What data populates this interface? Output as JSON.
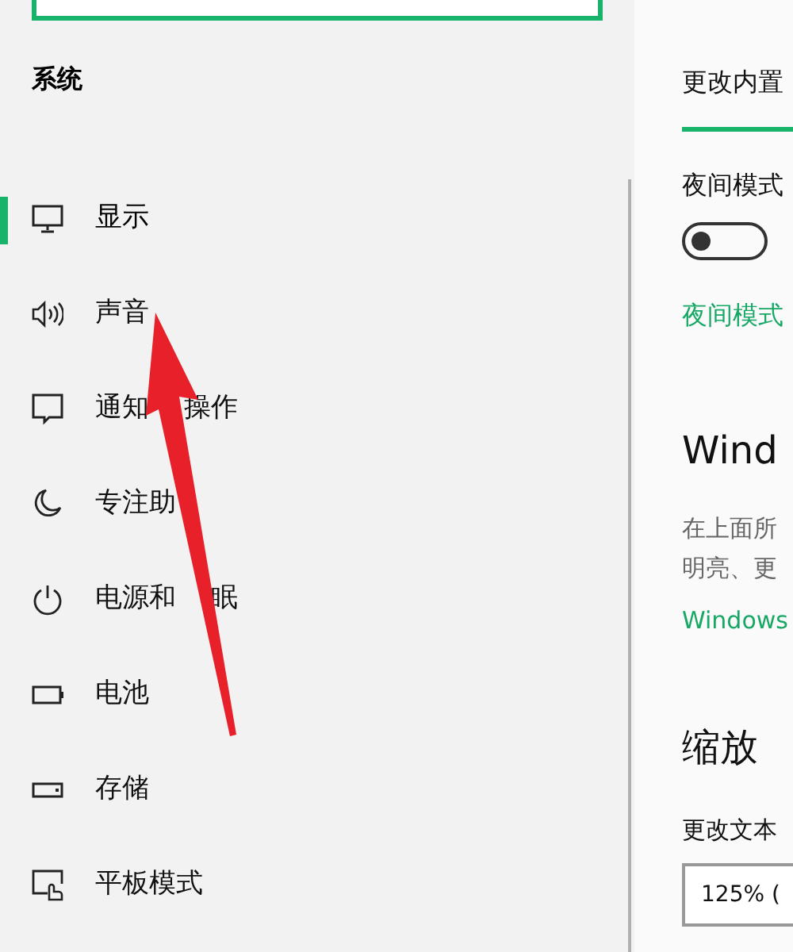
{
  "sidebar": {
    "section_title": "系统",
    "items": [
      {
        "label_parts": [
          "显示"
        ],
        "selected": true
      },
      {
        "label_parts": [
          "声音"
        ],
        "selected": false
      },
      {
        "label_parts": [
          "通知",
          "操作"
        ],
        "selected": false
      },
      {
        "label_parts": [
          "专注助"
        ],
        "selected": false
      },
      {
        "label_parts": [
          "电源和",
          "眠"
        ],
        "selected": false
      },
      {
        "label_parts": [
          "电池"
        ],
        "selected": false
      },
      {
        "label_parts": [
          "存储"
        ],
        "selected": false
      },
      {
        "label_parts": [
          "平板模式"
        ],
        "selected": false
      }
    ]
  },
  "content": {
    "brightness_label": "更改内置",
    "night_label": "夜间模式",
    "night_toggle": {
      "on": false
    },
    "night_link": "夜间模式",
    "hdr_title": "Wind",
    "hdr_text": [
      "在上面所",
      "明亮、更"
    ],
    "hdr_link": "Windows",
    "scale_title": "缩放",
    "scale_label": "更改文本",
    "scale_value": "125% ("
  }
}
